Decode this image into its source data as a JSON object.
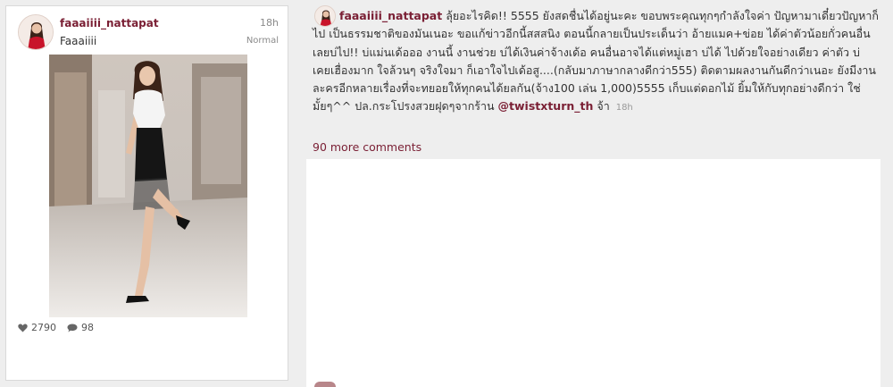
{
  "post": {
    "username": "faaaiiii_nattapat",
    "time": "18h",
    "caption": "Faaaiiii",
    "filter": "Normal",
    "photo_icon": "photo-woman-in-mall",
    "likes_icon": "heart-icon",
    "likes": "2790",
    "comments_icon": "comment-bubble-icon",
    "comments": "98"
  },
  "comment": {
    "username": "faaaiiii_nattapat",
    "text": "ลุ้ยอะไรคิด!! 5555 ยังสดชื่นได้อยู่นะคะ ขอบพระคุณทุกๆกำลังใจค่า ปัญหามาเดี๋ยวปัญหาก็ไป เป็นธรรมชาติของมันเนอะ ขอแก้ข่าวอีกนี้สสสนิง ตอนนี้กลายเป็นประเด็นว่า อ้ายแมค+ข่อย ได้ค่าตัวน้อยกั่วคนอื่น เลยบ่ไป!! บ่แม่นเด้อออ งานนี้ งานช่วย บ่ได้เงินค่าจ้างเด้อ คนอื่นอาจได้แต่หมู่เฮา บ่ได้ ไปด้วยใจอย่างเดียว ค่าตัว บ่ เคยเฮื่องมาก ใจล้วนๆ จริงใจมา ก็เอาใจไปเด้อสู....(กลับมาภาษากลางดีกว่า555) ติดตามผลงานกันดีกว่าเนอะ ยังมีงานละครอีกหลายเรื่องที่จะทยอยให้ทุกคนได้ยลกัน(จ้าง100 เล่น 1,000)5555 เก็บแต่ดอกไม้ ยิ้มให้กับทุกอย่างดีกว่า ใช่มั้ยๆ^^ ปล.กระโปรงสวยฝุดๆจากร้าน",
    "mention": "@twistxturn_th",
    "suffix": "จ้า",
    "time": "18h",
    "more": "90 more comments"
  }
}
